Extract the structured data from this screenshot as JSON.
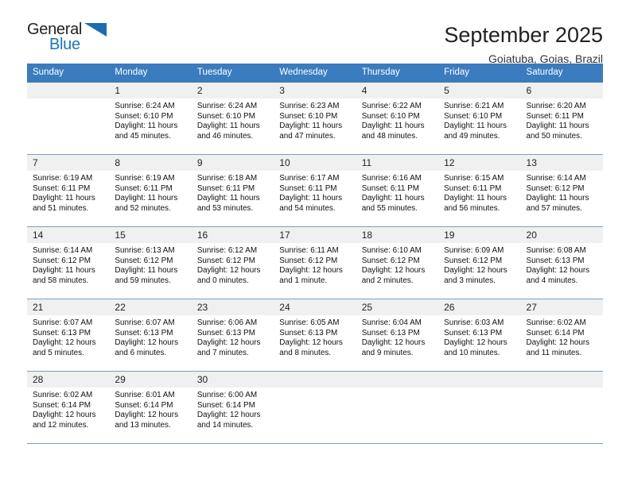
{
  "logo": {
    "word_top": "General",
    "word_bottom": "Blue",
    "triangle_color": "#1b6cb0",
    "blue_color": "#1b75bb"
  },
  "header": {
    "title": "September 2025",
    "subtitle": "Goiatuba, Goias, Brazil",
    "header_bg": "#3a7cbe",
    "daynum_bg": "#f0f0f0",
    "grid_line": "#7a9ec4"
  },
  "weekdays": [
    "Sunday",
    "Monday",
    "Tuesday",
    "Wednesday",
    "Thursday",
    "Friday",
    "Saturday"
  ],
  "labels": {
    "sunrise_prefix": "Sunrise:",
    "sunset_prefix": "Sunset:",
    "daylight_prefix": "Daylight:"
  },
  "weeks": [
    [
      {
        "day": "",
        "empty": true
      },
      {
        "day": "1",
        "sunrise": "Sunrise: 6:24 AM",
        "sunset": "Sunset: 6:10 PM",
        "daylight_line1": "Daylight: 11 hours",
        "daylight_line2": "and 45 minutes."
      },
      {
        "day": "2",
        "sunrise": "Sunrise: 6:24 AM",
        "sunset": "Sunset: 6:10 PM",
        "daylight_line1": "Daylight: 11 hours",
        "daylight_line2": "and 46 minutes."
      },
      {
        "day": "3",
        "sunrise": "Sunrise: 6:23 AM",
        "sunset": "Sunset: 6:10 PM",
        "daylight_line1": "Daylight: 11 hours",
        "daylight_line2": "and 47 minutes."
      },
      {
        "day": "4",
        "sunrise": "Sunrise: 6:22 AM",
        "sunset": "Sunset: 6:10 PM",
        "daylight_line1": "Daylight: 11 hours",
        "daylight_line2": "and 48 minutes."
      },
      {
        "day": "5",
        "sunrise": "Sunrise: 6:21 AM",
        "sunset": "Sunset: 6:10 PM",
        "daylight_line1": "Daylight: 11 hours",
        "daylight_line2": "and 49 minutes."
      },
      {
        "day": "6",
        "sunrise": "Sunrise: 6:20 AM",
        "sunset": "Sunset: 6:11 PM",
        "daylight_line1": "Daylight: 11 hours",
        "daylight_line2": "and 50 minutes."
      }
    ],
    [
      {
        "day": "7",
        "sunrise": "Sunrise: 6:19 AM",
        "sunset": "Sunset: 6:11 PM",
        "daylight_line1": "Daylight: 11 hours",
        "daylight_line2": "and 51 minutes."
      },
      {
        "day": "8",
        "sunrise": "Sunrise: 6:19 AM",
        "sunset": "Sunset: 6:11 PM",
        "daylight_line1": "Daylight: 11 hours",
        "daylight_line2": "and 52 minutes."
      },
      {
        "day": "9",
        "sunrise": "Sunrise: 6:18 AM",
        "sunset": "Sunset: 6:11 PM",
        "daylight_line1": "Daylight: 11 hours",
        "daylight_line2": "and 53 minutes."
      },
      {
        "day": "10",
        "sunrise": "Sunrise: 6:17 AM",
        "sunset": "Sunset: 6:11 PM",
        "daylight_line1": "Daylight: 11 hours",
        "daylight_line2": "and 54 minutes."
      },
      {
        "day": "11",
        "sunrise": "Sunrise: 6:16 AM",
        "sunset": "Sunset: 6:11 PM",
        "daylight_line1": "Daylight: 11 hours",
        "daylight_line2": "and 55 minutes."
      },
      {
        "day": "12",
        "sunrise": "Sunrise: 6:15 AM",
        "sunset": "Sunset: 6:11 PM",
        "daylight_line1": "Daylight: 11 hours",
        "daylight_line2": "and 56 minutes."
      },
      {
        "day": "13",
        "sunrise": "Sunrise: 6:14 AM",
        "sunset": "Sunset: 6:12 PM",
        "daylight_line1": "Daylight: 11 hours",
        "daylight_line2": "and 57 minutes."
      }
    ],
    [
      {
        "day": "14",
        "sunrise": "Sunrise: 6:14 AM",
        "sunset": "Sunset: 6:12 PM",
        "daylight_line1": "Daylight: 11 hours",
        "daylight_line2": "and 58 minutes."
      },
      {
        "day": "15",
        "sunrise": "Sunrise: 6:13 AM",
        "sunset": "Sunset: 6:12 PM",
        "daylight_line1": "Daylight: 11 hours",
        "daylight_line2": "and 59 minutes."
      },
      {
        "day": "16",
        "sunrise": "Sunrise: 6:12 AM",
        "sunset": "Sunset: 6:12 PM",
        "daylight_line1": "Daylight: 12 hours",
        "daylight_line2": "and 0 minutes."
      },
      {
        "day": "17",
        "sunrise": "Sunrise: 6:11 AM",
        "sunset": "Sunset: 6:12 PM",
        "daylight_line1": "Daylight: 12 hours",
        "daylight_line2": "and 1 minute."
      },
      {
        "day": "18",
        "sunrise": "Sunrise: 6:10 AM",
        "sunset": "Sunset: 6:12 PM",
        "daylight_line1": "Daylight: 12 hours",
        "daylight_line2": "and 2 minutes."
      },
      {
        "day": "19",
        "sunrise": "Sunrise: 6:09 AM",
        "sunset": "Sunset: 6:12 PM",
        "daylight_line1": "Daylight: 12 hours",
        "daylight_line2": "and 3 minutes."
      },
      {
        "day": "20",
        "sunrise": "Sunrise: 6:08 AM",
        "sunset": "Sunset: 6:13 PM",
        "daylight_line1": "Daylight: 12 hours",
        "daylight_line2": "and 4 minutes."
      }
    ],
    [
      {
        "day": "21",
        "sunrise": "Sunrise: 6:07 AM",
        "sunset": "Sunset: 6:13 PM",
        "daylight_line1": "Daylight: 12 hours",
        "daylight_line2": "and 5 minutes."
      },
      {
        "day": "22",
        "sunrise": "Sunrise: 6:07 AM",
        "sunset": "Sunset: 6:13 PM",
        "daylight_line1": "Daylight: 12 hours",
        "daylight_line2": "and 6 minutes."
      },
      {
        "day": "23",
        "sunrise": "Sunrise: 6:06 AM",
        "sunset": "Sunset: 6:13 PM",
        "daylight_line1": "Daylight: 12 hours",
        "daylight_line2": "and 7 minutes."
      },
      {
        "day": "24",
        "sunrise": "Sunrise: 6:05 AM",
        "sunset": "Sunset: 6:13 PM",
        "daylight_line1": "Daylight: 12 hours",
        "daylight_line2": "and 8 minutes."
      },
      {
        "day": "25",
        "sunrise": "Sunrise: 6:04 AM",
        "sunset": "Sunset: 6:13 PM",
        "daylight_line1": "Daylight: 12 hours",
        "daylight_line2": "and 9 minutes."
      },
      {
        "day": "26",
        "sunrise": "Sunrise: 6:03 AM",
        "sunset": "Sunset: 6:13 PM",
        "daylight_line1": "Daylight: 12 hours",
        "daylight_line2": "and 10 minutes."
      },
      {
        "day": "27",
        "sunrise": "Sunrise: 6:02 AM",
        "sunset": "Sunset: 6:14 PM",
        "daylight_line1": "Daylight: 12 hours",
        "daylight_line2": "and 11 minutes."
      }
    ],
    [
      {
        "day": "28",
        "sunrise": "Sunrise: 6:02 AM",
        "sunset": "Sunset: 6:14 PM",
        "daylight_line1": "Daylight: 12 hours",
        "daylight_line2": "and 12 minutes."
      },
      {
        "day": "29",
        "sunrise": "Sunrise: 6:01 AM",
        "sunset": "Sunset: 6:14 PM",
        "daylight_line1": "Daylight: 12 hours",
        "daylight_line2": "and 13 minutes."
      },
      {
        "day": "30",
        "sunrise": "Sunrise: 6:00 AM",
        "sunset": "Sunset: 6:14 PM",
        "daylight_line1": "Daylight: 12 hours",
        "daylight_line2": "and 14 minutes."
      },
      {
        "day": "",
        "empty": true
      },
      {
        "day": "",
        "empty": true
      },
      {
        "day": "",
        "empty": true
      },
      {
        "day": "",
        "empty": true
      }
    ]
  ]
}
